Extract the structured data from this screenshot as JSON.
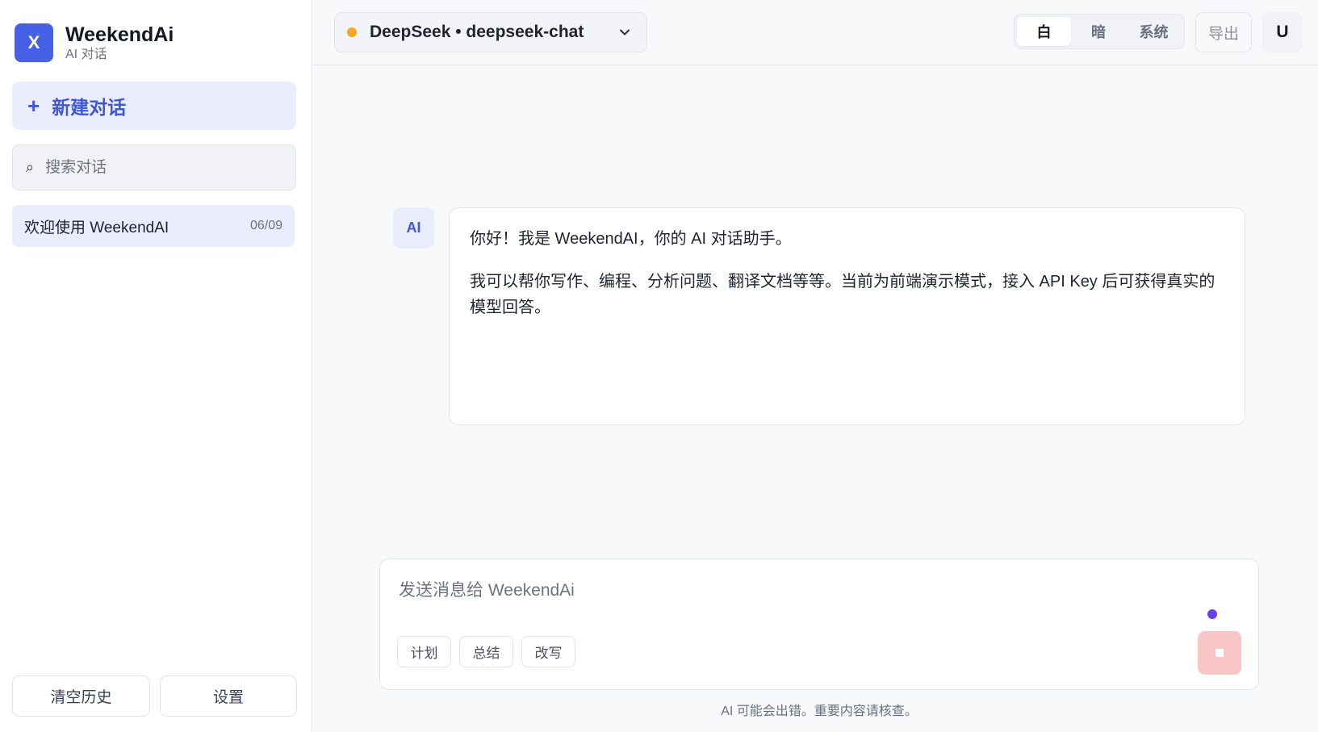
{
  "sidebar": {
    "logo_letter": "X",
    "brand_name": "WeekendAi",
    "brand_subtitle": "AI 对话",
    "new_chat_icon": "+",
    "new_chat_label": "新建对话",
    "search": {
      "icon": "⌕",
      "placeholder": "搜索对话",
      "value": ""
    },
    "conversations": [
      {
        "title": "欢迎使用 WeekendAI",
        "date": "06/09",
        "active": true
      }
    ],
    "clear_history_label": "清空历史",
    "settings_label": "设置"
  },
  "topbar": {
    "model": {
      "status_color": "#f5a623",
      "label": "DeepSeek • deepseek-chat",
      "icon": "chevron-down-icon"
    },
    "theme_options": [
      {
        "label": "白",
        "active": true
      },
      {
        "label": "暗",
        "active": false
      },
      {
        "label": "系统",
        "active": false
      }
    ],
    "export_label": "导出",
    "user_initial": "U"
  },
  "chat": {
    "messages": [
      {
        "role": "AI",
        "avatar_label": "AI",
        "paragraphs": [
          "你好！我是 WeekendAI，你的 AI 对话助手。",
          "我可以帮你写作、编程、分析问题、翻译文档等等。当前为前端演示模式，接入 API Key 后可获得真实的模型回答。"
        ]
      }
    ]
  },
  "composer": {
    "placeholder": "发送消息给 WeekendAi",
    "value": "",
    "quick_actions": [
      "计划",
      "总结",
      "改写"
    ],
    "status_color": "#6a41e6",
    "stop_button_color": "#f9c6c6"
  },
  "footer": {
    "disclaimer": "AI 可能会出错。重要内容请核查。"
  },
  "colors": {
    "accent": "#4660e6",
    "accent_light": "#e9edfd"
  }
}
